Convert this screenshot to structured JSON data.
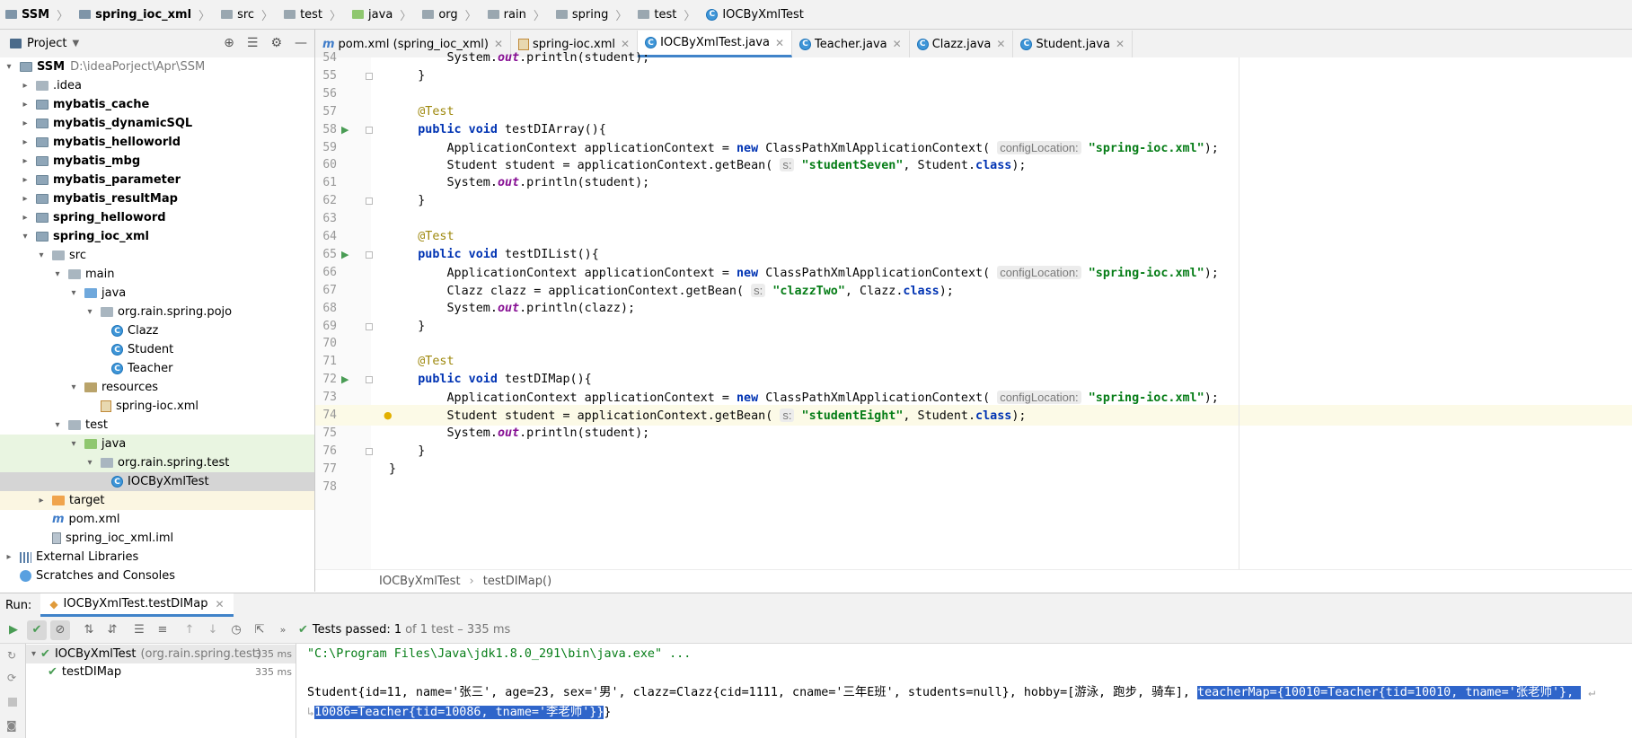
{
  "breadcrumb": [
    "SSM",
    "spring_ioc_xml",
    "src",
    "test",
    "java",
    "org",
    "rain",
    "spring",
    "test",
    "IOCByXmlTest"
  ],
  "project_panel": {
    "title": "Project"
  },
  "tree": [
    {
      "label": "SSM",
      "path": "D:\\ideaPorject\\Apr\\SSM",
      "level": 0,
      "arrow": "▾",
      "icon": "mod",
      "bold": true
    },
    {
      "label": ".idea",
      "level": 1,
      "arrow": "▸",
      "icon": "gray",
      "bold": false
    },
    {
      "label": "mybatis_cache",
      "level": 1,
      "arrow": "▸",
      "icon": "mod",
      "bold": true
    },
    {
      "label": "mybatis_dynamicSQL",
      "level": 1,
      "arrow": "▸",
      "icon": "mod",
      "bold": true
    },
    {
      "label": "mybatis_helloworld",
      "level": 1,
      "arrow": "▸",
      "icon": "mod",
      "bold": true
    },
    {
      "label": "mybatis_mbg",
      "level": 1,
      "arrow": "▸",
      "icon": "mod",
      "bold": true
    },
    {
      "label": "mybatis_parameter",
      "level": 1,
      "arrow": "▸",
      "icon": "mod",
      "bold": true
    },
    {
      "label": "mybatis_resultMap",
      "level": 1,
      "arrow": "▸",
      "icon": "mod",
      "bold": true
    },
    {
      "label": "spring_helloword",
      "level": 1,
      "arrow": "▸",
      "icon": "mod",
      "bold": true
    },
    {
      "label": "spring_ioc_xml",
      "level": 1,
      "arrow": "▾",
      "icon": "mod",
      "bold": true
    },
    {
      "label": "src",
      "level": 2,
      "arrow": "▾",
      "icon": "gray",
      "bold": false
    },
    {
      "label": "main",
      "level": 3,
      "arrow": "▾",
      "icon": "gray",
      "bold": false
    },
    {
      "label": "java",
      "level": 4,
      "arrow": "▾",
      "icon": "blue",
      "bold": false
    },
    {
      "label": "org.rain.spring.pojo",
      "level": 5,
      "arrow": "▾",
      "icon": "gray",
      "bold": false
    },
    {
      "label": "Clazz",
      "level": 6,
      "arrow": "",
      "icon": "class",
      "bold": false
    },
    {
      "label": "Student",
      "level": 6,
      "arrow": "",
      "icon": "class",
      "bold": false
    },
    {
      "label": "Teacher",
      "level": 6,
      "arrow": "",
      "icon": "class",
      "bold": false
    },
    {
      "label": "resources",
      "level": 4,
      "arrow": "▾",
      "icon": "res",
      "bold": false
    },
    {
      "label": "spring-ioc.xml",
      "level": 5,
      "arrow": "",
      "icon": "xml",
      "bold": false
    },
    {
      "label": "test",
      "level": 3,
      "arrow": "▾",
      "icon": "gray",
      "bold": false
    },
    {
      "label": "java",
      "level": 4,
      "arrow": "▾",
      "icon": "green",
      "bold": false,
      "hl": "green"
    },
    {
      "label": "org.rain.spring.test",
      "level": 5,
      "arrow": "▾",
      "icon": "gray",
      "bold": false,
      "hl": "green"
    },
    {
      "label": "IOCByXmlTest",
      "level": 6,
      "arrow": "",
      "icon": "class",
      "bold": false,
      "hl": "sel"
    },
    {
      "label": "target",
      "level": 2,
      "arrow": "▸",
      "icon": "orange",
      "bold": false,
      "hl": "tgt"
    },
    {
      "label": "pom.xml",
      "level": 2,
      "arrow": "",
      "icon": "m",
      "bold": false
    },
    {
      "label": "spring_ioc_xml.iml",
      "level": 2,
      "arrow": "",
      "icon": "iml",
      "bold": false
    },
    {
      "label": "External Libraries",
      "level": 0,
      "arrow": "▸",
      "icon": "lib",
      "bold": false
    },
    {
      "label": "Scratches and Consoles",
      "level": 0,
      "arrow": "",
      "icon": "scr",
      "bold": false
    }
  ],
  "tabs": [
    {
      "label": "pom.xml (spring_ioc_xml)",
      "icon": "m",
      "active": false
    },
    {
      "label": "spring-ioc.xml",
      "icon": "xml",
      "active": false
    },
    {
      "label": "IOCByXmlTest.java",
      "icon": "class",
      "active": true
    },
    {
      "label": "Teacher.java",
      "icon": "class",
      "active": false
    },
    {
      "label": "Clazz.java",
      "icon": "class",
      "active": false
    },
    {
      "label": "Student.java",
      "icon": "class",
      "active": false
    }
  ],
  "code": [
    {
      "n": "54",
      "t": "        System.<it>out</it>.println(student);"
    },
    {
      "n": "55",
      "t": "    }",
      "fold": true
    },
    {
      "n": "56",
      "t": ""
    },
    {
      "n": "57",
      "t": "    <ann>@Test</ann>"
    },
    {
      "n": "58",
      "t": "    <kw>public void</kw> testDIArray(){",
      "run": true,
      "fold": true
    },
    {
      "n": "59",
      "t": "        ApplicationContext applicationContext = <kw>new</kw> ClassPathXmlApplicationContext( <hint>configLocation:</hint> <str>\"spring-ioc.xml\"</str>);"
    },
    {
      "n": "60",
      "t": "        Student student = applicationContext.getBean( <hint>s:</hint> <str>\"studentSeven\"</str>, Student.<kw>class</kw>);"
    },
    {
      "n": "61",
      "t": "        System.<it>out</it>.println(student);"
    },
    {
      "n": "62",
      "t": "    }",
      "fold": true
    },
    {
      "n": "63",
      "t": ""
    },
    {
      "n": "64",
      "t": "    <ann>@Test</ann>"
    },
    {
      "n": "65",
      "t": "    <kw>public void</kw> testDIList(){",
      "run": true,
      "fold": true
    },
    {
      "n": "66",
      "t": "        ApplicationContext applicationContext = <kw>new</kw> ClassPathXmlApplicationContext( <hint>configLocation:</hint> <str>\"spring-ioc.xml\"</str>);"
    },
    {
      "n": "67",
      "t": "        Clazz clazz = applicationContext.getBean( <hint>s:</hint> <str>\"clazzTwo\"</str>, Clazz.<kw>class</kw>);"
    },
    {
      "n": "68",
      "t": "        System.<it>out</it>.println(clazz);"
    },
    {
      "n": "69",
      "t": "    }",
      "fold": true
    },
    {
      "n": "70",
      "t": ""
    },
    {
      "n": "71",
      "t": "    <ann>@Test</ann>"
    },
    {
      "n": "72",
      "t": "    <kw>public void</kw> testDIMap(){",
      "run": true,
      "fold": true
    },
    {
      "n": "73",
      "t": "        ApplicationContext applicationContext = <kw>new</kw> ClassPathXmlApplicationContext( <hint>configLocation:</hint> <str>\"spring-ioc.xml\"</str>);"
    },
    {
      "n": "74",
      "t": "        Student student = applicationContext.getBean( <hint>s:</hint> <str>\"studentEight\"</str>, Student.<kw>class</kw>);",
      "hl": true,
      "bulb": true
    },
    {
      "n": "75",
      "t": "        System.<it>out</it>.println(student);"
    },
    {
      "n": "76",
      "t": "    }",
      "fold": true
    },
    {
      "n": "77",
      "t": "}"
    },
    {
      "n": "78",
      "t": ""
    }
  ],
  "editor_breadcrumb": {
    "cls": "IOCByXmlTest",
    "method": "testDIMap()"
  },
  "run": {
    "label": "Run:",
    "tab": "IOCByXmlTest.testDIMap",
    "status_prefix": "Tests passed:",
    "status_count": "1",
    "status_suffix": "of 1 test – 335 ms",
    "tree": [
      {
        "label": "IOCByXmlTest",
        "pkg": "(org.rain.spring.test)",
        "ms": "335 ms",
        "level": 0
      },
      {
        "label": "testDIMap",
        "pkg": "",
        "ms": "335 ms",
        "level": 1
      }
    ],
    "console": {
      "cmd": "\"C:\\Program Files\\Java\\jdk1.8.0_291\\bin\\java.exe\" ...",
      "out1": "Student{id=11, name='张三', age=23, sex='男', clazz=Clazz{cid=1111, cname='三年E班', students=null}, hobby=[游泳, 跑步, 骑车], ",
      "out1_sel": "teacherMap={10010=Teacher{tid=10010, tname='张老师'}, ",
      "out2_sel": "10086=Teacher{tid=10086, tname='李老师'}}",
      "out2_end": "}"
    }
  }
}
